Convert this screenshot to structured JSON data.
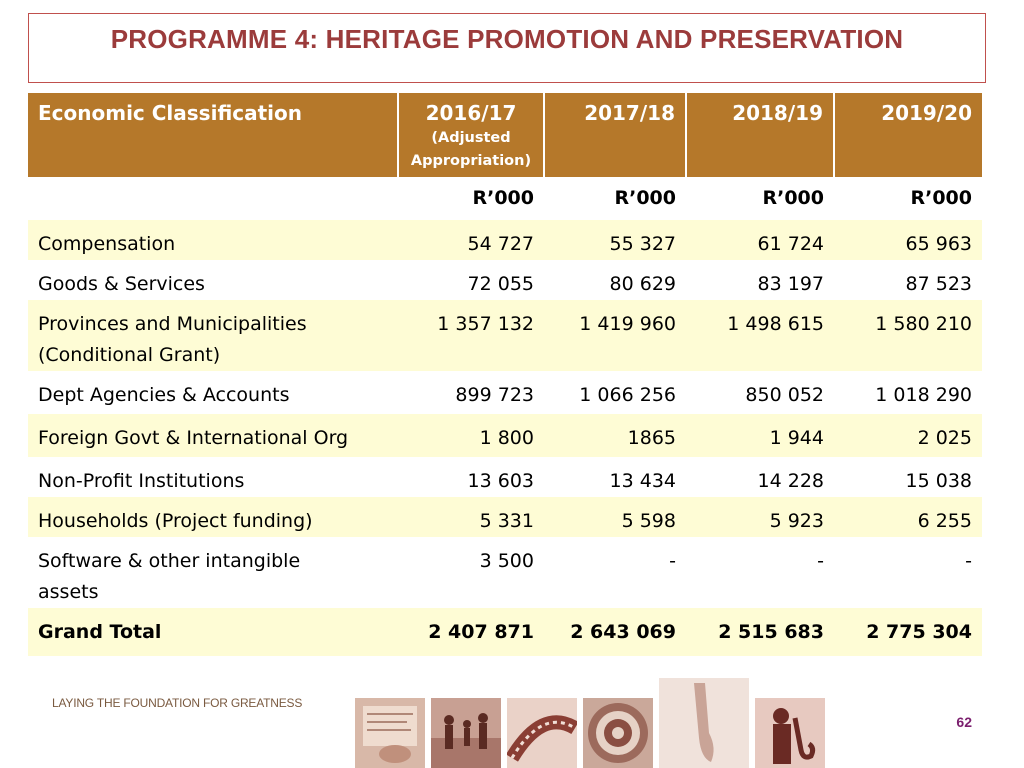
{
  "title": "PROGRAMME 4: HERITAGE PROMOTION AND PRESERVATION",
  "table": {
    "headers": [
      {
        "label": "Economic Classification",
        "sub": ""
      },
      {
        "label": "2016/17",
        "sub": "(Adjusted Appropriation)"
      },
      {
        "label": "2017/18",
        "sub": ""
      },
      {
        "label": "2018/19",
        "sub": ""
      },
      {
        "label": "2019/20",
        "sub": ""
      }
    ],
    "units": [
      "",
      "R’000",
      "R’000",
      "R’000",
      "R’000"
    ],
    "rows": [
      {
        "label": "Compensation",
        "values": [
          "54 727",
          "55 327",
          "61 724",
          "65 963"
        ]
      },
      {
        "label": "Goods & Services",
        "values": [
          "72 055",
          "80 629",
          "83 197",
          "87 523"
        ]
      },
      {
        "label": "Provinces and Municipalities (Conditional Grant)",
        "values": [
          "1 357 132",
          "1 419 960",
          "1 498 615",
          "1 580 210"
        ]
      },
      {
        "label": "Dept Agencies & Accounts",
        "values": [
          "899 723",
          "1 066 256",
          "850 052",
          "1 018 290"
        ]
      },
      {
        "label": "Foreign Govt & International Org",
        "values": [
          "1 800",
          "1865",
          "1 944",
          "2 025"
        ]
      },
      {
        "label": "Non-Profit Institutions",
        "values": [
          "13 603",
          "13 434",
          "14 228",
          "15 038"
        ]
      },
      {
        "label": "Households (Project funding)",
        "values": [
          "5 331",
          "5 598",
          "5 923",
          "6 255"
        ]
      },
      {
        "label": "Software & other intangible assets",
        "values": [
          "3 500",
          "-",
          "-",
          "-"
        ]
      }
    ],
    "total": {
      "label": "Grand Total",
      "values": [
        "2 407 871",
        "2 643 069",
        "2 515 683",
        "2 775 304"
      ]
    }
  },
  "footer": {
    "tagline": "LAYING THE FOUNDATION FOR GREATNESS",
    "page_number": "62"
  },
  "colors": {
    "header_bg": "#b5782a",
    "title": "#9b3b3b",
    "row_shade": "#fefcd5",
    "page_number": "#7b1f6e"
  }
}
